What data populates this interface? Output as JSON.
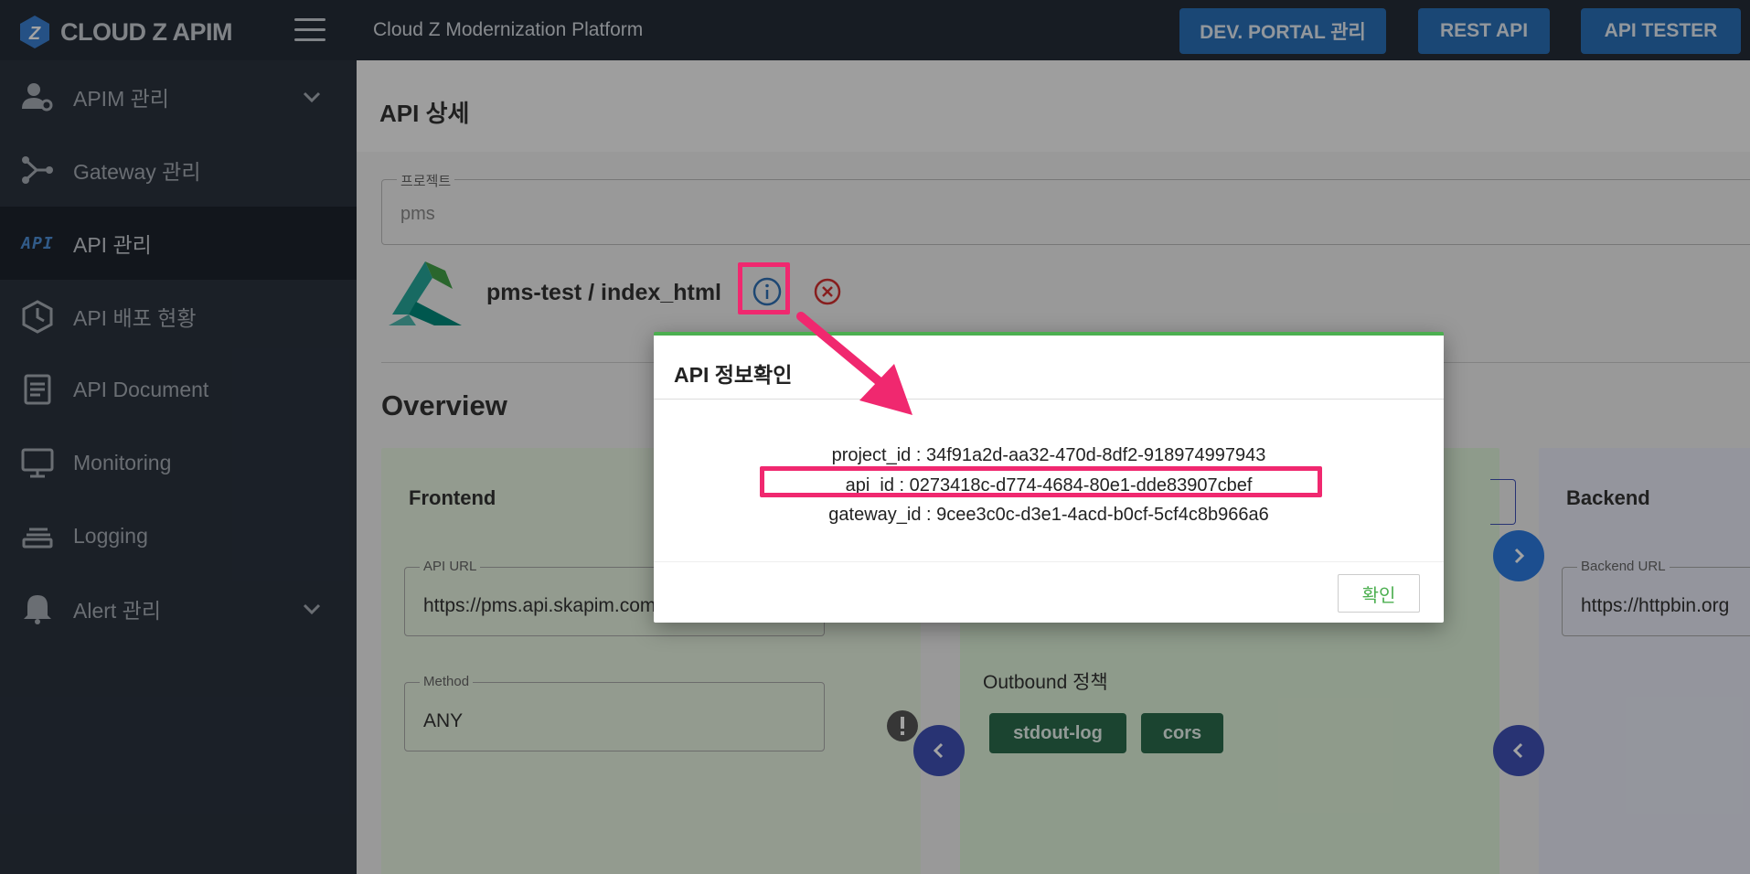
{
  "topbar": {
    "logo_text": "CLOUD Z APIM",
    "platform_title": "Cloud Z Modernization Platform",
    "buttons": [
      {
        "label": "DEV. PORTAL 관리"
      },
      {
        "label": "REST API"
      },
      {
        "label": "API TESTER"
      }
    ]
  },
  "sidebar": {
    "items": [
      {
        "label": "APIM 관리",
        "icon": "user-gear-icon",
        "expandable": true
      },
      {
        "label": "Gateway 관리",
        "icon": "network-icon"
      },
      {
        "label": "API 관리",
        "icon": "api-icon",
        "icon_text": "API",
        "active": true
      },
      {
        "label": "API 배포 현황",
        "icon": "package-icon"
      },
      {
        "label": "API Document",
        "icon": "document-icon"
      },
      {
        "label": "Monitoring",
        "icon": "monitor-icon"
      },
      {
        "label": "Logging",
        "icon": "logging-icon"
      },
      {
        "label": "Alert 관리",
        "icon": "bell-icon",
        "expandable": true
      }
    ]
  },
  "main": {
    "page_title": "API 상세",
    "project": {
      "label": "프로젝트",
      "value": "pms"
    },
    "api_name": "pms-test / index_html",
    "overview_title": "Overview",
    "frontend": {
      "title": "Frontend",
      "api_url_label": "API URL",
      "api_url_value": "https://pms.api.skapim.com",
      "method_label": "Method",
      "method_value": "ANY"
    },
    "policies": {
      "outbound_label": "Outbound 정책",
      "outbound_chips": [
        "stdout-log",
        "cors"
      ]
    },
    "backend": {
      "title": "Backend",
      "url_label": "Backend URL",
      "url_value": "https://httpbin.org"
    }
  },
  "modal": {
    "title": "API 정보확인",
    "project_id": "project_id : 34f91a2d-aa32-470d-8df2-918974997943",
    "api_id": "api_id : 0273418c-d774-4684-80e1-dde83907cbef",
    "gateway_id": "gateway_id : 9cee3c0c-d3e1-4acd-b0cf-5cf4c8b966a6",
    "confirm_label": "확인"
  },
  "colors": {
    "topbar_bg": "#242c38",
    "sidebar_bg": "#2b323e",
    "primary_button": "#2a6fb8",
    "modal_accent": "#4caf50",
    "highlight": "#f0286f",
    "chip": "#2b6b4c"
  }
}
